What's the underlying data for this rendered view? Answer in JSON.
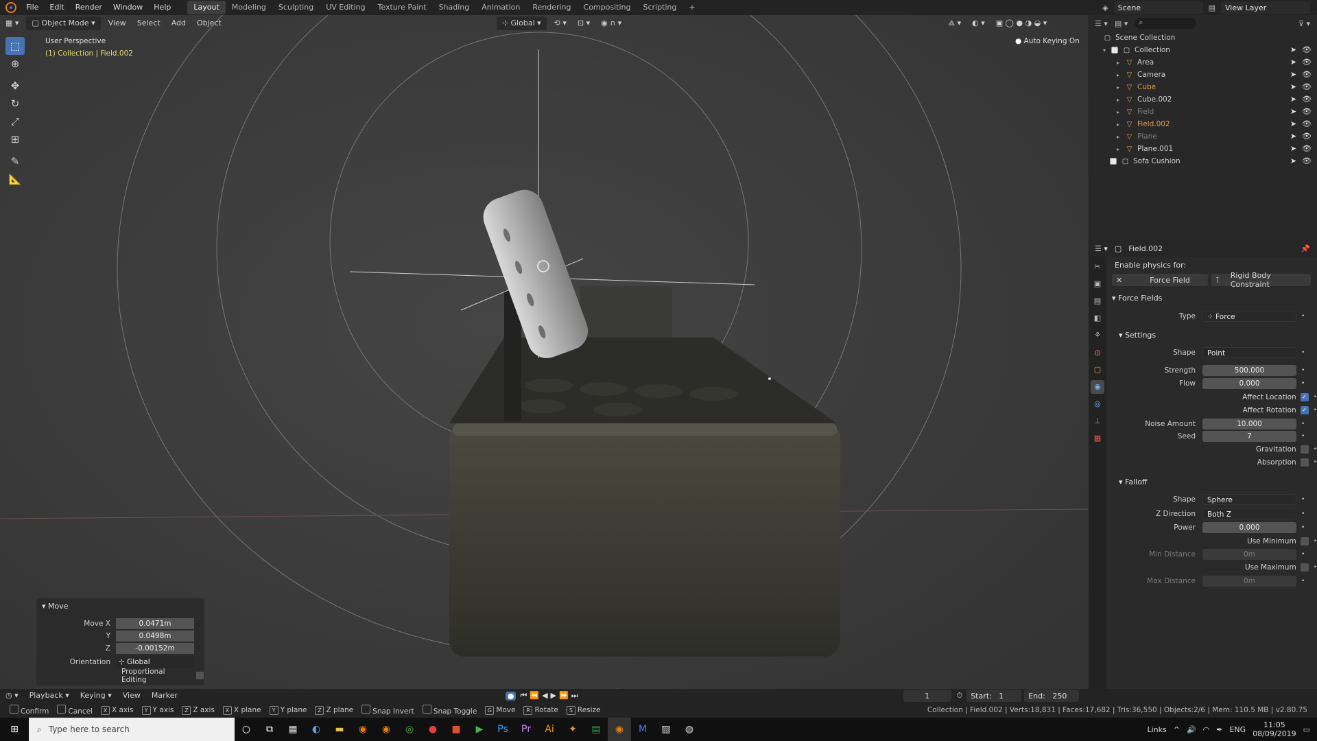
{
  "menu": {
    "items": [
      "File",
      "Edit",
      "Render",
      "Window",
      "Help"
    ]
  },
  "workspaces": [
    {
      "label": "Layout",
      "active": true
    },
    {
      "label": "Modeling"
    },
    {
      "label": "Sculpting"
    },
    {
      "label": "UV Editing"
    },
    {
      "label": "Texture Paint"
    },
    {
      "label": "Shading"
    },
    {
      "label": "Animation"
    },
    {
      "label": "Rendering"
    },
    {
      "label": "Compositing"
    },
    {
      "label": "Scripting"
    }
  ],
  "topright": {
    "scene": "Scene",
    "view_layer": "View Layer"
  },
  "viewport": {
    "mode": "Object Mode",
    "menus": [
      "View",
      "Select",
      "Add",
      "Object"
    ],
    "orientation": "Global",
    "perspective": "User Perspective",
    "context": "(1) Collection | Field.002",
    "autokey": "Auto Keying On"
  },
  "outliner": {
    "root": "Scene Collection",
    "collection": "Collection",
    "items": [
      {
        "name": "Area",
        "color": "#d0d0d0"
      },
      {
        "name": "Camera",
        "color": "#d0d0d0"
      },
      {
        "name": "Cube",
        "color": "#e8a04a"
      },
      {
        "name": "Cube.002",
        "color": "#d0d0d0"
      },
      {
        "name": "Field",
        "color": "#808080"
      },
      {
        "name": "Field.002",
        "color": "#e8a04a"
      },
      {
        "name": "Plane",
        "color": "#808080"
      },
      {
        "name": "Plane.001",
        "color": "#d0d0d0"
      }
    ],
    "extra": "Sofa Cushion"
  },
  "properties": {
    "object": "Field.002",
    "enable_physics": "Enable physics for:",
    "force_field_btn": "Force Field",
    "rigid_btn": "Rigid Body Constraint",
    "force_fields": "Force Fields",
    "type_label": "Type",
    "type_value": "Force",
    "settings": "Settings",
    "shape_label": "Shape",
    "shape_value": "Point",
    "strength_label": "Strength",
    "strength_value": "500.000",
    "flow_label": "Flow",
    "flow_value": "0.000",
    "affect_location": "Affect Location",
    "affect_rotation": "Affect Rotation",
    "noise_label": "Noise Amount",
    "noise_value": "10.000",
    "seed_label": "Seed",
    "seed_value": "7",
    "gravitation": "Gravitation",
    "absorption": "Absorption",
    "falloff": "Falloff",
    "fshape_label": "Shape",
    "fshape_value": "Sphere",
    "zdir_label": "Z Direction",
    "zdir_value": "Both Z",
    "power_label": "Power",
    "power_value": "0.000",
    "use_min": "Use Minimum",
    "min_label": "Min Distance",
    "min_value": "0m",
    "use_max": "Use Maximum",
    "max_label": "Max Distance",
    "max_value": "0m"
  },
  "movepanel": {
    "title": "Move",
    "x_label": "Move X",
    "x": "0.0471m",
    "y_label": "Y",
    "y": "0.0498m",
    "z_label": "Z",
    "z": "-0.00152m",
    "orient_label": "Orientation",
    "orient": "Global",
    "prop_edit": "Proportional Editing"
  },
  "timeline": {
    "menus": [
      "Playback",
      "Keying",
      "View",
      "Marker"
    ],
    "current": "1",
    "start_label": "Start:",
    "start": "1",
    "end_label": "End:",
    "end": "250"
  },
  "status": {
    "hints": [
      {
        "key": "",
        "label": "Confirm"
      },
      {
        "key": "",
        "label": "Cancel"
      },
      {
        "key": "X",
        "label": "X axis"
      },
      {
        "key": "Y",
        "label": "Y axis"
      },
      {
        "key": "Z",
        "label": "Z axis"
      },
      {
        "key": "X",
        "label": "X plane"
      },
      {
        "key": "Y",
        "label": "Y plane"
      },
      {
        "key": "Z",
        "label": "Z plane"
      },
      {
        "key": "",
        "label": "Snap Invert"
      },
      {
        "key": "",
        "label": "Snap Toggle"
      },
      {
        "key": "G",
        "label": "Move"
      },
      {
        "key": "R",
        "label": "Rotate"
      },
      {
        "key": "S",
        "label": "Resize"
      }
    ],
    "info": "Collection | Field.002 | Verts:18,831 | Faces:17,682 | Tris:36,550 | Objects:2/6 | Mem: 110.5 MB | v2.80.75"
  },
  "taskbar": {
    "search_placeholder": "Type here to search",
    "links": "Links",
    "lang": "ENG",
    "time": "11:05",
    "date": "08/09/2019"
  }
}
